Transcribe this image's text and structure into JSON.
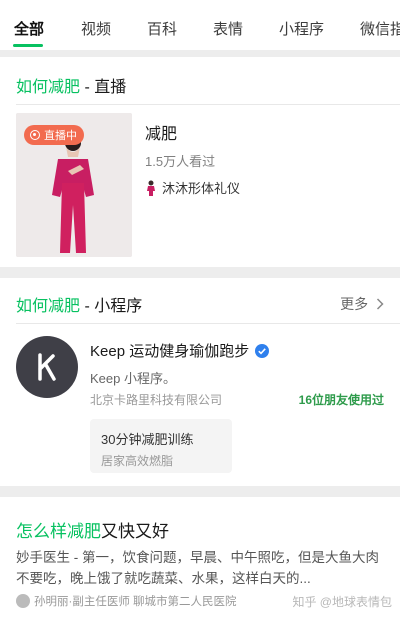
{
  "tabs": [
    {
      "label": "全部",
      "active": true
    },
    {
      "label": "视频"
    },
    {
      "label": "百科"
    },
    {
      "label": "表情"
    },
    {
      "label": "小程序"
    },
    {
      "label": "微信指"
    }
  ],
  "live_section": {
    "keyword": "如何减肥",
    "suffix": " - 直播",
    "badge": "直播中",
    "title": "减肥",
    "viewers": "1.5万人看过",
    "host": "沐沐形体礼仪"
  },
  "mini_section": {
    "keyword": "如何减肥",
    "suffix": " - 小程序",
    "more": "更多",
    "app_name": "Keep 运动健身瑜伽跑步",
    "app_desc": "Keep 小程序。",
    "company": "北京卡路里科技有限公司",
    "friends": "16位朋友使用过",
    "service_title": "30分钟减肥训练",
    "service_sub": "居家高效燃脂"
  },
  "article": {
    "keyword": "怎么样减肥",
    "title_rest": "又快又好",
    "body": "妙手医生 - 第一，饮食问题，早晨、中午照吃，但是大鱼大肉不要吃，晚上饿了就吃蔬菜、水果，这样白天的...",
    "source": "孙明丽·副主任医师 聊城市第二人民医院",
    "watermark": "知乎 @地球表情包"
  },
  "colors": {
    "accent": "#07c160",
    "live_badge": "#f26b4f",
    "logo_bg": "#3f3f47",
    "verified": "#2f80ed"
  }
}
